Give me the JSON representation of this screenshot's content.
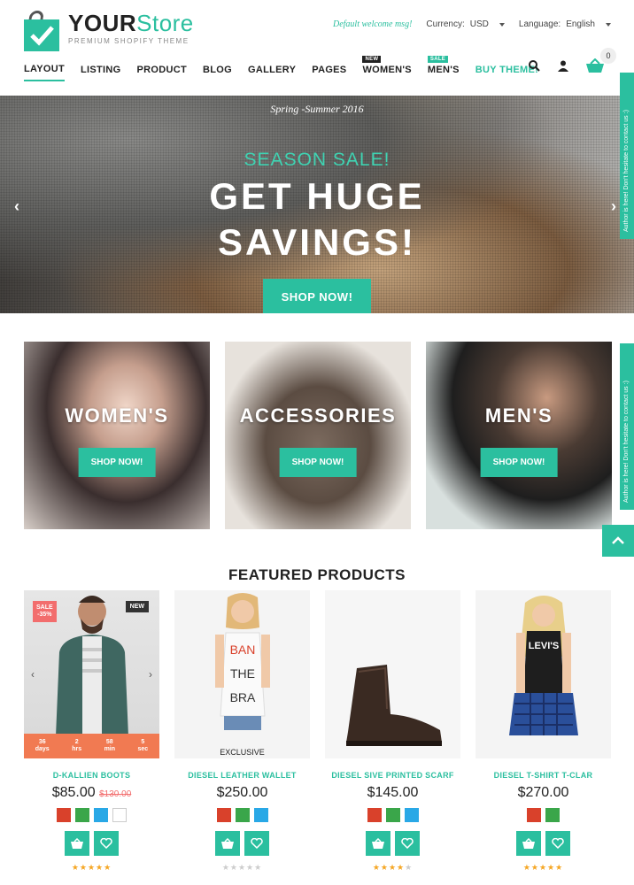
{
  "header": {
    "logo_your": "YOUR",
    "logo_store": "Store",
    "logo_tagline": "PREMIUM SHOPIFY THEME",
    "welcome": "Default welcome msg!",
    "currency_label": "Currency:",
    "currency_value": "USD",
    "language_label": "Language:",
    "language_value": "English",
    "cart_count": "0",
    "nav": [
      {
        "label": "LAYOUT",
        "active": true
      },
      {
        "label": "LISTING"
      },
      {
        "label": "PRODUCT"
      },
      {
        "label": "BLOG"
      },
      {
        "label": "GALLERY"
      },
      {
        "label": "PAGES"
      },
      {
        "label": "WOMEN'S",
        "badge": "NEW"
      },
      {
        "label": "MEN'S",
        "badge": "SALE"
      },
      {
        "label": "BUY THEME!"
      }
    ]
  },
  "hero": {
    "pretitle": "Spring -Summer 2016",
    "season": "SEASON SALE!",
    "title_line1": "GET HUGE",
    "title_line2": "SAVINGS!",
    "cta": "SHOP NOW!",
    "prev": "‹",
    "next": "›"
  },
  "side_tab_text": "Author is here! Don't hesitate to contact us :)",
  "categories": [
    {
      "title": "WOMEN'S",
      "cta": "SHOP NOW!"
    },
    {
      "title": "ACCESSORIES",
      "cta": "SHOP NOW!"
    },
    {
      "title": "MEN'S",
      "cta": "SHOP NOW!"
    }
  ],
  "featured": {
    "title": "FEATURED PRODUCTS",
    "products": [
      {
        "name": "D-KALLIEN BOOTS",
        "price": "$85.00",
        "old_price": "$130.00",
        "sale_badge_line1": "SALE",
        "sale_badge_line2": "-35%",
        "new_badge": "NEW",
        "countdown": [
          {
            "value": "36",
            "unit": "days"
          },
          {
            "value": "2",
            "unit": "hrs"
          },
          {
            "value": "58",
            "unit": "min"
          },
          {
            "value": "5",
            "unit": "sec"
          }
        ],
        "swatches": [
          "#d9412b",
          "#3aa64a",
          "#29a8e6",
          "#ffffff"
        ],
        "rating": 5
      },
      {
        "name": "DIESEL LEATHER WALLET",
        "price": "$250.00",
        "label": "EXCLUSIVE",
        "swatches": [
          "#d9412b",
          "#3aa64a",
          "#29a8e6"
        ],
        "rating": 0
      },
      {
        "name": "DIESEL SIVE PRINTED SCARF",
        "price": "$145.00",
        "swatches": [
          "#d9412b",
          "#3aa64a",
          "#29a8e6"
        ],
        "rating": 4
      },
      {
        "name": "DIESEL T-SHIRT T-CLAR",
        "price": "$270.00",
        "swatches": [
          "#d9412b",
          "#3aa64a"
        ],
        "rating": 5
      }
    ],
    "product1_figure_text": [
      "BAN",
      "THE",
      "BRA"
    ],
    "product4_shirt_text": "LEVI'S"
  },
  "colors": {
    "accent": "#2bbf9f",
    "sale": "#f26d6d",
    "countdown": "#f17a52"
  }
}
